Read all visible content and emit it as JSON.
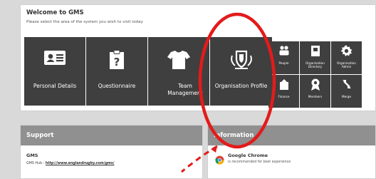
{
  "welcome": {
    "title": "Welcome to GMS",
    "subtitle": "Please select the area of the system you wish to visit today"
  },
  "tiles": [
    {
      "label": "Personal Details",
      "icon": "id-card-icon"
    },
    {
      "label": "Questionnaire",
      "icon": "clipboard-question-icon"
    },
    {
      "label": "Team Management",
      "icon": "jersey-icon"
    },
    {
      "label": "Organisation Profile",
      "icon": "shield-crest-icon"
    }
  ],
  "small_tiles": [
    {
      "label": "People",
      "icon": "people-icon"
    },
    {
      "label": "Organisation Directory",
      "icon": "directory-book-icon"
    },
    {
      "label": "Organisation Admin",
      "icon": "gear-icon"
    },
    {
      "label": "Finance",
      "icon": "finance-icon"
    },
    {
      "label": "Members",
      "icon": "member-badge-icon"
    },
    {
      "label": "Merge",
      "icon": "merge-icon"
    }
  ],
  "support": {
    "heading": "Support",
    "title": "GMS",
    "hub_prefix": "GMS Hub - ",
    "hub_link": "http://www.englandrugby.com/gms/"
  },
  "information": {
    "heading": "Information",
    "browser_title": "Google Chrome",
    "browser_note": "is recommended for best experience"
  },
  "colors": {
    "tile": "#3f3f3f",
    "panel_header": "#909090",
    "annotation": "#e31b1b"
  }
}
